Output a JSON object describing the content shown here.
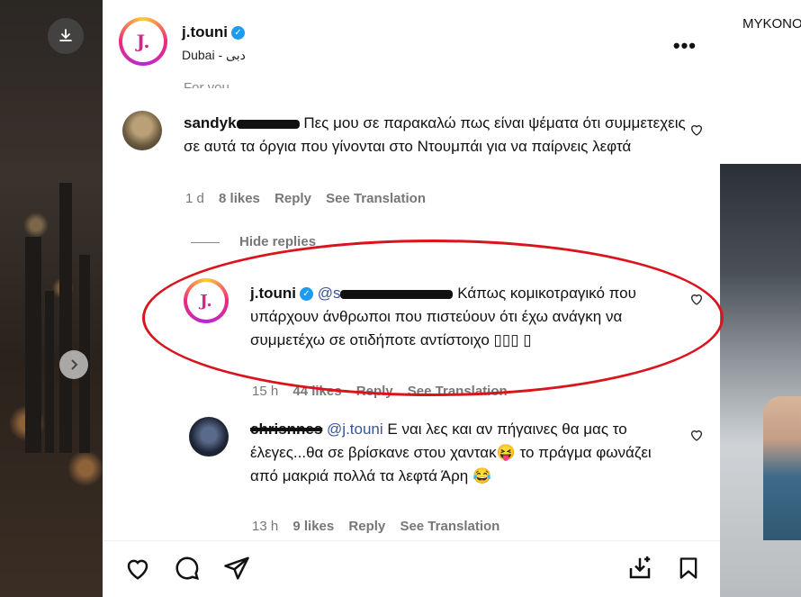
{
  "right_heading": "MYKONO",
  "post": {
    "author": "j.touni",
    "location": "Dubai - دبی",
    "avatar_letter": "J."
  },
  "section_label": "For you",
  "comments": [
    {
      "user": "sandyk",
      "text": "Πες μου σε παρακαλώ πως είναι ψέματα ότι συμμετεχεις σε αυτά τα όργια που γίνονται στο Ντουμπάι για να παίρνεις λεφτά",
      "time": "1 d",
      "likes": "8 likes",
      "reply": "Reply",
      "translate": "See Translation"
    }
  ],
  "hide_replies": "Hide replies",
  "replies": [
    {
      "user": "j.touni",
      "mention": "@s",
      "text": "Κάπως κομικοτραγικό που υπάρχουν άνθρωποι που πιστεύουν ότι έχω ανάγκη να συμμετέχω σε οτιδήποτε αντίστοιχο ▯▯▯ ▯",
      "time": "15 h",
      "likes": "44 likes",
      "reply": "Reply",
      "translate": "See Translation"
    },
    {
      "user": "chrisnnes",
      "mention": "@j.touni",
      "text_1": "Ε ναι λες και αν πήγαινες θα μας το έλεγες...θα σε βρίσκανε στου χαντακ",
      "emoji_1": "😝",
      "text_2": "το πράγμα φωνάζει από μακριά πολλά τα λεφτά Άρη",
      "emoji_2": "😂",
      "time": "13 h",
      "likes": "9 likes",
      "reply": "Reply",
      "translate": "See Translation"
    }
  ],
  "colors": {
    "verified": "#1d9bf0",
    "annotation": "#d9141c",
    "brand": "#d1278a"
  },
  "icons": [
    "download-icon",
    "chevron-right-icon",
    "more-icon",
    "heart-icon",
    "comment-icon",
    "share-icon",
    "save-collection-icon",
    "bookmark-icon"
  ]
}
